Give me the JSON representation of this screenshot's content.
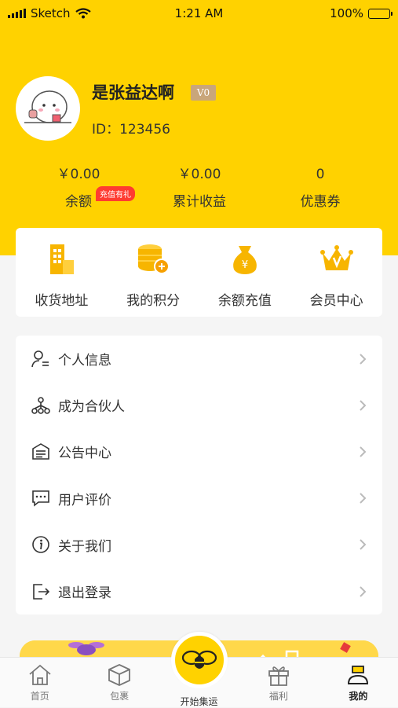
{
  "status_bar": {
    "carrier": "Sketch",
    "time": "1:21 AM",
    "battery": "100%"
  },
  "profile": {
    "username": "是张益达啊",
    "level": "V0",
    "id_text": "ID：123456"
  },
  "stats": [
    {
      "value": "￥0.00",
      "label": "余额"
    },
    {
      "value": "￥0.00",
      "label": "累计收益"
    },
    {
      "value": "0",
      "label": "优惠券"
    }
  ],
  "promo_tag": "充值有礼",
  "quick_actions": [
    {
      "label": "收货地址",
      "icon": "building-icon"
    },
    {
      "label": "我的积分",
      "icon": "coins-stack-icon"
    },
    {
      "label": "余额充值",
      "icon": "money-bag-icon"
    },
    {
      "label": "会员中心",
      "icon": "crown-icon"
    }
  ],
  "menu": [
    {
      "label": "个人信息",
      "icon": "person-card-icon"
    },
    {
      "label": "成为合伙人",
      "icon": "network-icon"
    },
    {
      "label": "公告中心",
      "icon": "notice-icon"
    },
    {
      "label": "用户评价",
      "icon": "comment-icon"
    },
    {
      "label": "关于我们",
      "icon": "info-icon"
    },
    {
      "label": "退出登录",
      "icon": "logout-icon"
    }
  ],
  "tabs": [
    {
      "label": "首页",
      "icon": "home-icon"
    },
    {
      "label": "包裹",
      "icon": "package-icon"
    },
    {
      "label": "开始集运",
      "icon": "bee-icon"
    },
    {
      "label": "福利",
      "icon": "gift-icon"
    },
    {
      "label": "我的",
      "icon": "user-blob-icon"
    }
  ],
  "colors": {
    "brand_yellow": "#ffd200",
    "badge_red": "#ff3b30",
    "level_badge": "#c9a67a",
    "icon_yellow": "#f7b500"
  }
}
